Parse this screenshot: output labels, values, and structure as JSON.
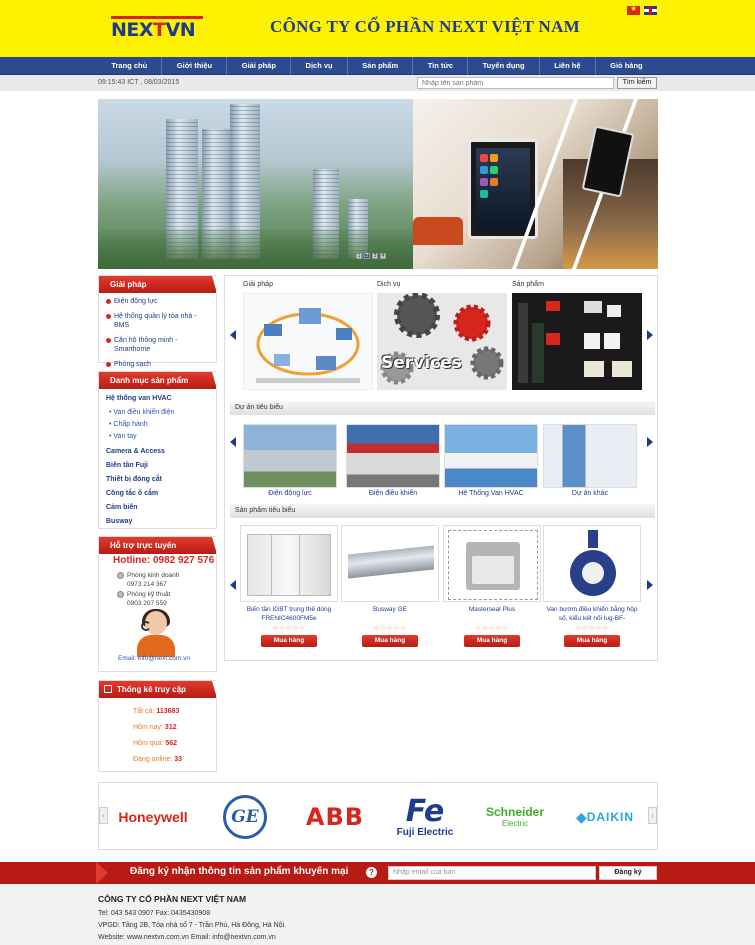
{
  "header": {
    "logo_left": "NEX",
    "logo_t": "T",
    "logo_right": "VN",
    "company_name": "CÔNG TY CỔ PHẦN NEXT VIỆT NAM",
    "languages": [
      "vn-flag-icon",
      "uk-flag-icon"
    ]
  },
  "nav": {
    "items": [
      "Trang chủ",
      "Giới thiệu",
      "Giải pháp",
      "Dịch vụ",
      "Sản phẩm",
      "Tin tức",
      "Tuyển dụng",
      "Liên hệ",
      "Giỏ hàng"
    ]
  },
  "util": {
    "datetime": "09:15:43 ICT , 08/03/2015",
    "search_placeholder": "Nhập tên sản phẩm",
    "search_button": "Tìm kiếm"
  },
  "banner": {
    "pager": [
      "1",
      "2",
      "3",
      "4"
    ],
    "active_page": "2"
  },
  "sidebar": {
    "solutions": {
      "title": "Giải pháp",
      "items": [
        "Điện động lực",
        "Hệ thống quản lý tòa nhà -BMS",
        "Căn hộ thông minh - Smarthome",
        "Phòng sạch"
      ]
    },
    "categories": {
      "title": "Danh mục sản phẩm",
      "hvac": "Hệ thống van HVAC",
      "hvac_sub": [
        "Van điều khiển điện",
        "Chấp hành",
        "Van tay"
      ],
      "others": [
        "Camera & Access",
        "Biến tần Fuji",
        "Thiết bị đóng cắt",
        "Công tắc ổ cắm",
        "Cảm biến",
        "Busway"
      ]
    },
    "support": {
      "title": "Hỗ trợ trực tuyến",
      "hotline": "Hotline: 0982 927 576",
      "sales_label": "Phòng kinh doanh",
      "sales_phone": "0973 214 367",
      "tech_label": "Phòng kỹ thuật",
      "tech_phone": "0903 207 559",
      "email": "Email: info@next.com.vn"
    },
    "stats": {
      "title": "Thống kê truy cập",
      "rows": [
        {
          "label": "Tất cả:",
          "value": "113683"
        },
        {
          "label": "Hôm nay:",
          "value": "312"
        },
        {
          "label": "Hôm qua:",
          "value": "562"
        },
        {
          "label": "Đang online:",
          "value": "33"
        }
      ]
    }
  },
  "main": {
    "top_cards": [
      "Giải pháp",
      "Dịch vụ",
      "Sản phẩm"
    ],
    "services_text": "Services",
    "featured_projects_title": "Dự án tiêu biểu",
    "projects": [
      "Điện động lực",
      "Điện điều khiển",
      "Hệ Thống Van HVAC",
      "Dự án khác"
    ],
    "featured_products_title": "Sản phẩm tiêu biểu",
    "products": [
      {
        "name": "Biến tần IGBT trung thế dòng FRENIC4600FM5e",
        "stars": "☆☆☆☆☆",
        "button": "Mua hàng"
      },
      {
        "name": "Busway GE",
        "stars": "☆☆☆☆☆",
        "button": "Mua hàng"
      },
      {
        "name": "Masterseal Plus",
        "stars": "☆☆☆☆☆",
        "button": "Mua hàng"
      },
      {
        "name": "Van bướm điều khiển bằng hộp số, kiểu kết nối lug-BF-",
        "stars": "☆☆☆☆☆",
        "button": "Mua hàng"
      }
    ]
  },
  "partners": {
    "logos": [
      "Honeywell",
      "GE",
      "ABB",
      "Fuji Electric",
      "Schneider Electric",
      "DAIKIN"
    ],
    "fuji_mark": "Fe",
    "schneider_top": "Schneider",
    "schneider_bottom": "Electric",
    "prev": "‹",
    "next": "›"
  },
  "newsletter": {
    "title": "Đăng ký nhận thông tin sản phẩm khuyến mại",
    "help": "?",
    "placeholder": "Nhập email của bạn",
    "button": "Đăng ký"
  },
  "footer": {
    "company": "CÔNG TY CỔ PHẦN NEXT VIỆT NAM",
    "phone": "Tel: 043 543 0907 Fax: 0435430908",
    "address": "VPGD: Tầng 2B, Tòa nhà số 7 - Trần Phú, Hà Đông, Hà Nội.",
    "web": "Website: www.nextvn.com.vn Email: info@nextvn.com.vn"
  },
  "colors": {
    "header_yellow": "#fff200",
    "nav_blue": "#2c4a8f",
    "accent_red": "#d7261e",
    "link_blue": "#1f3c8c"
  }
}
